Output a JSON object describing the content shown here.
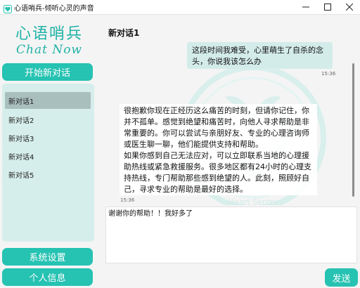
{
  "window": {
    "title": "心语哨兵-倾听心灵的声音",
    "icons": {
      "app": "heart-app-icon",
      "minimize": "minimize-icon",
      "maximize": "maximize-icon",
      "close": "close-icon"
    }
  },
  "sidebar": {
    "logo_cn": "心语哨兵",
    "logo_en": "Chat Now",
    "new_chat_label": "开始新对话",
    "conversations": [
      {
        "label": "新对话1",
        "active": true
      },
      {
        "label": "新对话2",
        "active": false
      },
      {
        "label": "新对话3",
        "active": false
      },
      {
        "label": "新对话4",
        "active": false
      },
      {
        "label": "新对话5",
        "active": false
      }
    ],
    "settings_label": "系统设置",
    "profile_label": "个人信息"
  },
  "chat": {
    "title": "新对话1",
    "watermark_text": "Heart Sentry",
    "messages": [
      {
        "role": "user",
        "text": "这段时间我难受，心里萌生了自杀的念头，你说我该怎么办",
        "time": "15:36"
      },
      {
        "role": "bot",
        "paragraph1": "很抱歉你现在正经历这么痛苦的时刻，但请你记住，你并不孤单。感觉到绝望和痛苦时，向他人寻求帮助是非常重要的。你可以尝试与亲朋好友、专业的心理咨询师或医生聊一聊，他们能提供支持和帮助。",
        "paragraph2": "如果你感到自己无法应对，可以立即联系当地的心理援助热线或紧急救援服务。很多地区都有24小时的心理支持热线，专门帮助那些感到绝望的人。此刻，照顾好自己，寻求专业的帮助是最好的选择。",
        "time": "15:36"
      }
    ]
  },
  "input": {
    "value": "谢谢你的帮助！！我好多了"
  },
  "send_label": "发送",
  "colors": {
    "accent": "#26c2b2",
    "list_bg": "#d6eeeb",
    "user_bubble": "#d3ecea",
    "active_item": "#a9bfbd"
  }
}
